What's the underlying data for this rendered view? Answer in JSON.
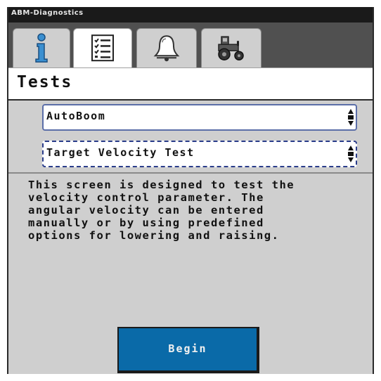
{
  "window": {
    "title": "ABM-Diagnostics"
  },
  "tabs": [
    {
      "icon": "info-icon",
      "active": false
    },
    {
      "icon": "checklist-icon",
      "active": true
    },
    {
      "icon": "alarm-bell-icon",
      "active": false
    },
    {
      "icon": "tractor-icon",
      "active": false
    }
  ],
  "page": {
    "title": "Tests"
  },
  "module_select": {
    "value": "AutoBoom"
  },
  "test_select": {
    "value": "Target Velocity Test"
  },
  "description": "This screen is designed to test the\nvelocity control parameter. The\nangular velocity can be entered\nmanually or by using predefined\noptions for lowering and raising.",
  "actions": {
    "begin_label": "Begin"
  },
  "colors": {
    "accent": "#0a6aa8",
    "select_border": "#5b6ea8",
    "background": "#cfcfcf"
  }
}
